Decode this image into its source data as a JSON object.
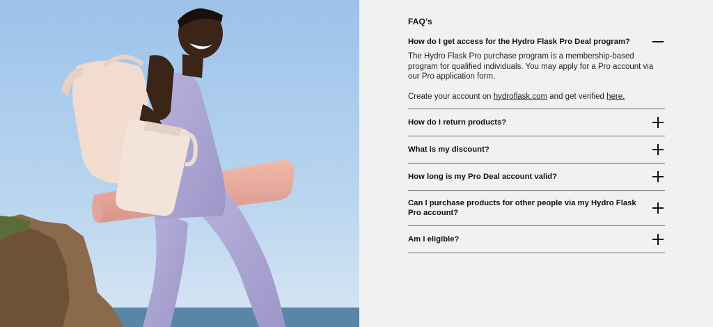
{
  "faq": {
    "title": "FAQ’s",
    "open_item": {
      "question": "How do I get access for the Hydro Flask Pro Deal program?",
      "answer_paragraph": "The Hydro Flask Pro purchase program is a membership-based program for qualified individuals. You may apply for a Pro account via our Pro application form.",
      "create_prefix": "Create your account on ",
      "create_link": "hydroflask.com",
      "create_middle": " and get verified ",
      "verify_link": "here."
    },
    "items": [
      {
        "question": "How do I return products?"
      },
      {
        "question": "What is my discount?"
      },
      {
        "question": "How long is my Pro Deal account valid?"
      },
      {
        "question": "Can I purchase products for other people via my Hydro Flask Pro account?"
      },
      {
        "question": "Am I eligible?"
      }
    ]
  },
  "hero": {
    "icon": "woman-with-bag-tumbler-yoga-mat-photo"
  },
  "colors": {
    "panel_bg": "#f1f1f1",
    "text": "#111111",
    "divider": "#6e6e6e"
  }
}
